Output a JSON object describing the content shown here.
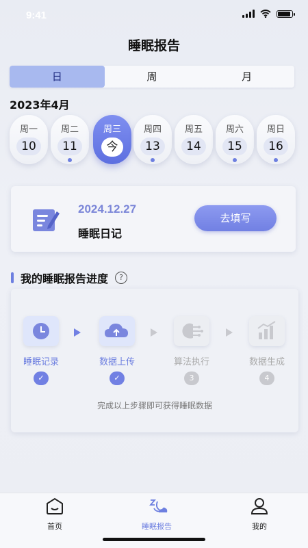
{
  "status": {
    "time": "9:41"
  },
  "header": {
    "title": "睡眠报告"
  },
  "segments": {
    "items": [
      "日",
      "周",
      "月"
    ],
    "active": 0
  },
  "calendar": {
    "month": "2023年4月",
    "days": [
      {
        "weekday": "周一",
        "number": "10",
        "dot": false
      },
      {
        "weekday": "周二",
        "number": "11",
        "dot": true
      },
      {
        "weekday": "周三",
        "number": "今",
        "dot": false,
        "today": true
      },
      {
        "weekday": "周四",
        "number": "13",
        "dot": true
      },
      {
        "weekday": "周五",
        "number": "14",
        "dot": false
      },
      {
        "weekday": "周六",
        "number": "15",
        "dot": true
      },
      {
        "weekday": "周日",
        "number": "16",
        "dot": true
      }
    ]
  },
  "diary": {
    "date": "2024.12.27",
    "title": "睡眠日记",
    "button": "去填写"
  },
  "progress": {
    "title": "我的睡眠报告进度",
    "help_icon": "?",
    "steps": [
      {
        "label": "睡眠记录",
        "status": "done",
        "badge": "✓",
        "icon": "clock-icon"
      },
      {
        "label": "数据上传",
        "status": "done",
        "badge": "✓",
        "icon": "cloud-upload-icon"
      },
      {
        "label": "算法执行",
        "status": "pending",
        "badge": "3",
        "icon": "brain-icon"
      },
      {
        "label": "数据生成",
        "status": "pending",
        "badge": "4",
        "icon": "bar-chart-icon"
      }
    ],
    "hint": "完成以上步骤即可获得睡眠数据"
  },
  "tabbar": {
    "items": [
      {
        "label": "首页",
        "icon": "home-icon"
      },
      {
        "label": "睡眠报告",
        "icon": "sleep-report-icon",
        "active": true
      },
      {
        "label": "我的",
        "icon": "user-icon"
      }
    ]
  },
  "colors": {
    "accent": "#7180e3",
    "accent_light": "#a8b9ef",
    "inactive": "#c8c9ce"
  }
}
